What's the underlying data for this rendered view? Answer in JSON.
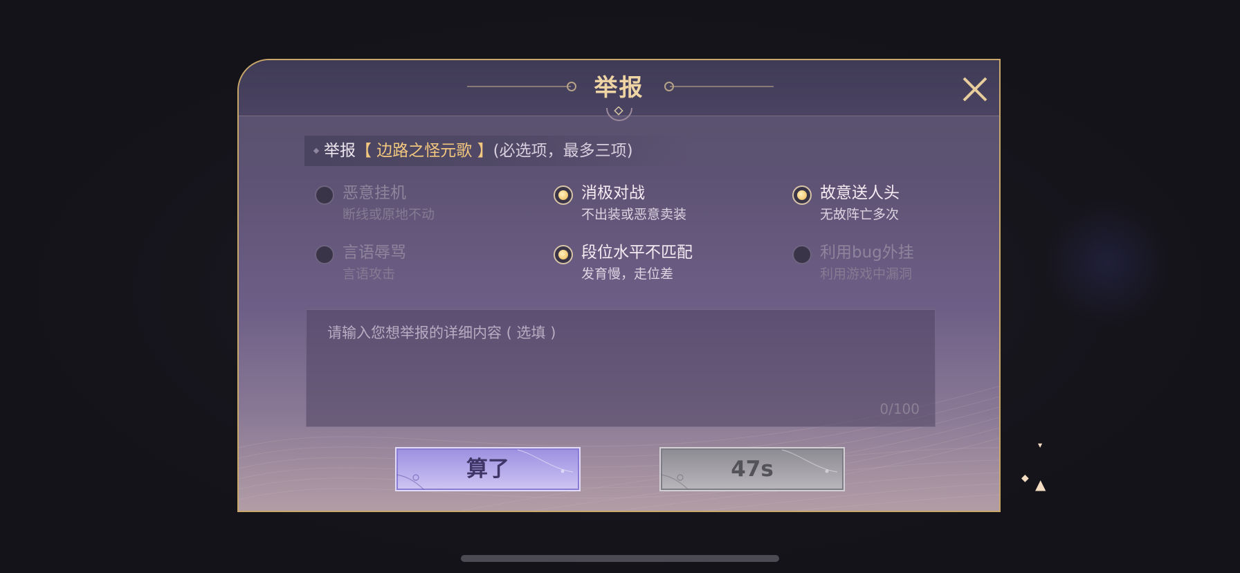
{
  "dialog": {
    "title": "举报",
    "close_icon": "close-icon"
  },
  "subject": {
    "prefix": "举报",
    "target": "【 边路之怪元歌 】",
    "hint": "(必选项，最多三项)"
  },
  "options": [
    {
      "title": "恶意挂机",
      "subtitle": "断线或原地不动",
      "checked": false
    },
    {
      "title": "消极对战",
      "subtitle": "不出装或恶意卖装",
      "checked": true
    },
    {
      "title": "故意送人头",
      "subtitle": "无故阵亡多次",
      "checked": true
    },
    {
      "title": "言语辱骂",
      "subtitle": "言语攻击",
      "checked": false
    },
    {
      "title": "段位水平不匹配",
      "subtitle": "发育慢，走位差",
      "checked": true
    },
    {
      "title": "利用bug外挂",
      "subtitle": "利用游戏中漏洞",
      "checked": false
    }
  ],
  "detail": {
    "placeholder": "请输入您想举报的详细内容 ( 选填 )",
    "counter": "0/100"
  },
  "buttons": {
    "cancel_label": "算了",
    "timer_label": "47s"
  },
  "colors": {
    "accent_gold": "#f0d5a4",
    "highlight_name": "#f2c77e",
    "border_gold": "#c9a86a",
    "cancel_button": "#b7aceb",
    "disabled_button": "#a5a3a9"
  }
}
